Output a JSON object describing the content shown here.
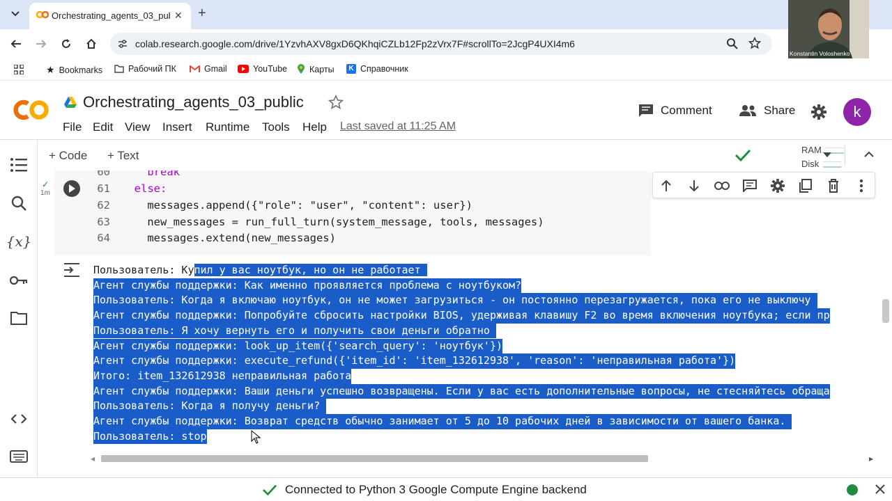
{
  "browser": {
    "tab_title": "Orchestrating_agents_03_publ",
    "url": "colab.research.google.com/drive/1YzvhAXV8gxD6QKhqiCZLb12Fp2zVrx7F#scrollTo=2JcgP4UXI4m6",
    "bookmarks": [
      "Bookmarks",
      "Рабочий ПК",
      "Gmail",
      "YouTube",
      "Карты",
      "Справочник"
    ]
  },
  "webcam": {
    "name": "Konstantin Voloshenko"
  },
  "colab": {
    "logo": "CO",
    "title": "Orchestrating_agents_03_public",
    "menu": [
      "File",
      "Edit",
      "View",
      "Insert",
      "Runtime",
      "Tools",
      "Help"
    ],
    "last_saved": "Last saved at 11:25 AM",
    "comment": "Comment",
    "share": "Share",
    "avatar_letter": "k",
    "add_code": "+ Code",
    "add_text": "+ Text",
    "ram": "RAM",
    "disk": "Disk"
  },
  "cell": {
    "status": "1m",
    "lines": [
      {
        "n": "60",
        "text": "    break"
      },
      {
        "n": "61",
        "text": "  else:"
      },
      {
        "n": "62",
        "text": "    messages.append({\"role\": \"user\", \"content\": user})"
      },
      {
        "n": "63",
        "text": "    new_messages = run_full_turn(system_message, tools, messages)"
      },
      {
        "n": "64",
        "text": "    messages.extend(new_messages)"
      }
    ]
  },
  "output": {
    "first_line_unselected": "Пользователь: Ку",
    "first_line_selected": "пил у вас ноутбук, но он не работает ",
    "lines": [
      "Агент службы поддержки: Как именно проявляется проблема с ноутбуком?",
      "Пользователь: Когда я включаю ноутбук, он не может загрузиться - он постоянно перезагружается, пока его не выключу ",
      "Агент службы поддержки: Попробуйте сбросить настройки BIOS, удерживая клавишу F2 во время включения ноутбука; если пр",
      "Пользователь: Я хочу вернуть его и получить свои деньги обратно ",
      "Агент службы поддержки: look_up_item({'search_query': 'ноутбук'})",
      "Агент службы поддержки: execute_refund({'item_id': 'item_132612938', 'reason': 'неправильная работа'})",
      "Итого: item_132612938 неправильная работа",
      "Агент службы поддержки: Ваши деньги успешно возвращены. Если у вас есть дополнительные вопросы, не стесняйтесь обраща",
      "Пользователь: Когда я получу деньги? ",
      "Агент службы поддержки: Возврат средств обычно занимает от 5 до 10 рабочих дней в зависимости от вашего банка. ",
      "Пользователь: stop"
    ]
  },
  "status_bar": {
    "text": "Connected to Python 3 Google Compute Engine backend"
  }
}
